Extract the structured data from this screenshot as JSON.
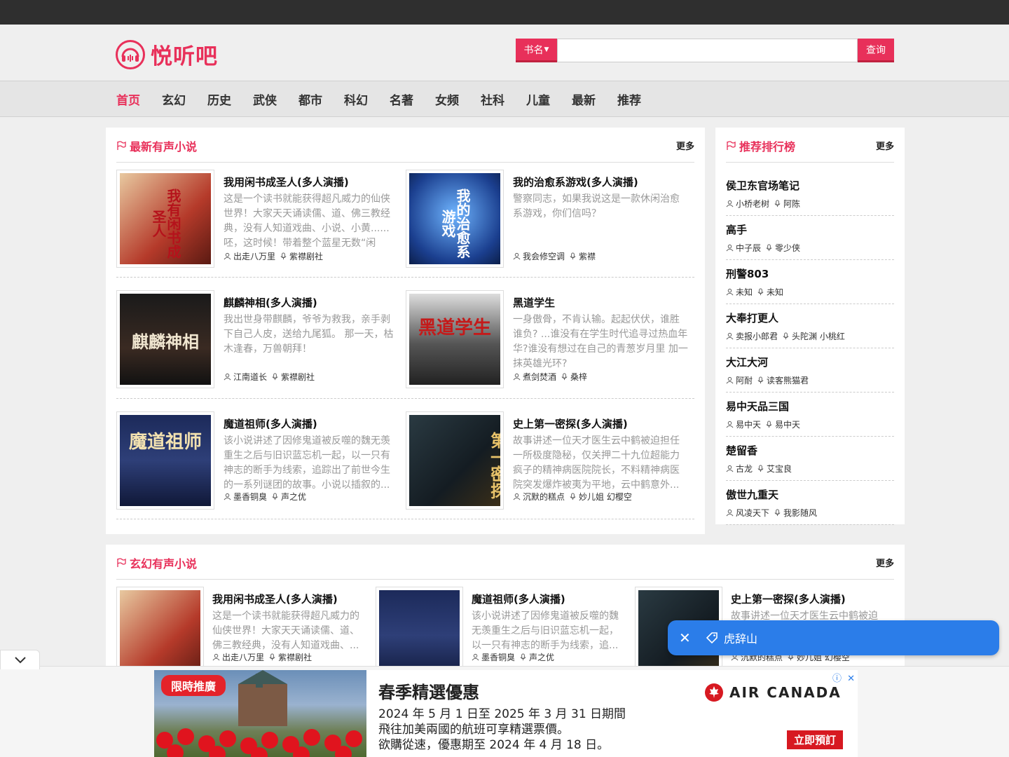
{
  "site": {
    "name": "悦听吧"
  },
  "search": {
    "type_label": "书名",
    "button_label": "查询",
    "placeholder": ""
  },
  "nav": [
    "首页",
    "玄幻",
    "历史",
    "武侠",
    "都市",
    "科幻",
    "名著",
    "女频",
    "社科",
    "儿童",
    "最新",
    "推荐"
  ],
  "latest": {
    "title": "最新有声小说",
    "more": "更多",
    "books": [
      {
        "title": "我用闲书成圣人(多人演播)",
        "desc": "这是一个读书就能获得超凡威力的仙侠世界！大家天天诵读儒、道、佛三教经典，没有人知道戏曲、小说、小黄......呸，这时候！带着整个蓝星无数“闲书”...",
        "author": "出走八万里",
        "narrator": "紫襟剧社",
        "cover_text": "我有闲书成圣人",
        "cover_color": "#c9a27a"
      },
      {
        "title": "我的治愈系游戏(多人演播)",
        "desc": "警察同志，如果我说这是一款休闲治愈系游戏，你们信吗？",
        "author": "我会修空调",
        "narrator": "紫襟",
        "cover_text": "我的治愈系游戏",
        "cover_color": "#1f4fa8"
      },
      {
        "title": "麒麟神相(多人演播)",
        "desc": "我出世身带麒麟，爷爷为救我，亲手剥下自己人皮，送给九尾狐。 那一天，枯木逢春，万兽朝拜！",
        "author": "江南道长",
        "narrator": "紫襟剧社",
        "cover_text": "麒麟神相",
        "cover_color": "#2a2a2a"
      },
      {
        "title": "黑道学生",
        "desc": "一身傲骨，不肯认输。起起伏伏，谁胜谁负? ...谁没有在学生时代追寻过热血年华?谁没有想过在自己的青葱岁月里 加一抹英雄光环?",
        "author": "煮剑焚酒",
        "narrator": "桑梓",
        "cover_text": "黑道学生",
        "cover_color": "#3a3a3a"
      },
      {
        "title": "魔道祖师(多人演播)",
        "desc": "该小说讲述了因修鬼道被反噬的魏无羡重生之后与旧识蓝忘机一起，以一只有神志的断手为线索，追踪出了前世今生的一系列谜团的故事。小说以插叙的...",
        "author": "墨香铜臭",
        "narrator": "声之优",
        "cover_text": "魔道祖师",
        "cover_color": "#1e2a55"
      },
      {
        "title": "史上第一密探(多人演播)",
        "desc": "故事讲述一位天才医生云中鹤被迫担任一所极度隐秘，仅关押二十九位超能力疯子的精神病医院院长，不料精神病医院突发爆炸被夷为平地，云中鹤意外...",
        "author": "沉默的糕点",
        "narrator": "妙儿姐 幻樱空",
        "cover_text": "第一密探",
        "cover_color": "#2a3238"
      }
    ]
  },
  "ranking": {
    "title": "推荐排行榜",
    "more": "更多",
    "items": [
      {
        "title": "侯卫东官场笔记",
        "author": "小桥老树",
        "narrator": "阿陈"
      },
      {
        "title": "高手",
        "author": "中子辰",
        "narrator": "零少侠"
      },
      {
        "title": "刑警803",
        "author": "未知",
        "narrator": "未知"
      },
      {
        "title": "大奉打更人",
        "author": "卖报小郎君",
        "narrator": "头陀渊 小桃红"
      },
      {
        "title": "大江大河",
        "author": "阿耐",
        "narrator": "读客熊猫君"
      },
      {
        "title": "易中天品三国",
        "author": "易中天",
        "narrator": "易中天"
      },
      {
        "title": "楚留香",
        "author": "古龙",
        "narrator": "艾宝良"
      },
      {
        "title": "傲世九重天",
        "author": "风凌天下",
        "narrator": "我影随风"
      }
    ]
  },
  "fantasy": {
    "title": "玄幻有声小说",
    "more": "更多",
    "books": [
      {
        "title": "我用闲书成圣人(多人演播)",
        "desc": "这是一个读书就能获得超凡威力的仙侠世界！大家天天诵读儒、道、佛三教经典，没有人知道戏曲、...",
        "author": "出走八万里",
        "narrator": "紫襟剧社"
      },
      {
        "title": "魔道祖师(多人演播)",
        "desc": "该小说讲述了因修鬼道被反噬的魏无羡重生之后与旧识蓝忘机一起，以一只有神志的断手为线索，追...",
        "author": "墨香铜臭",
        "narrator": "声之优"
      },
      {
        "title": "史上第一密探(多人演播)",
        "desc": "故事讲述一位天才医生云中鹤被迫",
        "author": "沉默的糕点",
        "narrator": "妙儿姐 幻樱空"
      }
    ]
  },
  "floating_tag": {
    "label": "虎辞山"
  },
  "ad": {
    "badge": "限時推廣",
    "headline": "春季精選優惠",
    "line1": "2024 年 5 月 1 日至 2025 年 3 月 31 日期間",
    "line2": "飛往加美兩國的航班可享精選票價。",
    "line3": "欲購從速，優惠期至 2024 年 4 月 18 日。",
    "brand": "AIR CANADA",
    "cta": "立即預訂",
    "colors": {
      "brand_red": "#d71921"
    }
  },
  "colors": {
    "accent": "#e8305a",
    "topbar": "#2f2f2f",
    "float_blue": "#2b7de9"
  }
}
